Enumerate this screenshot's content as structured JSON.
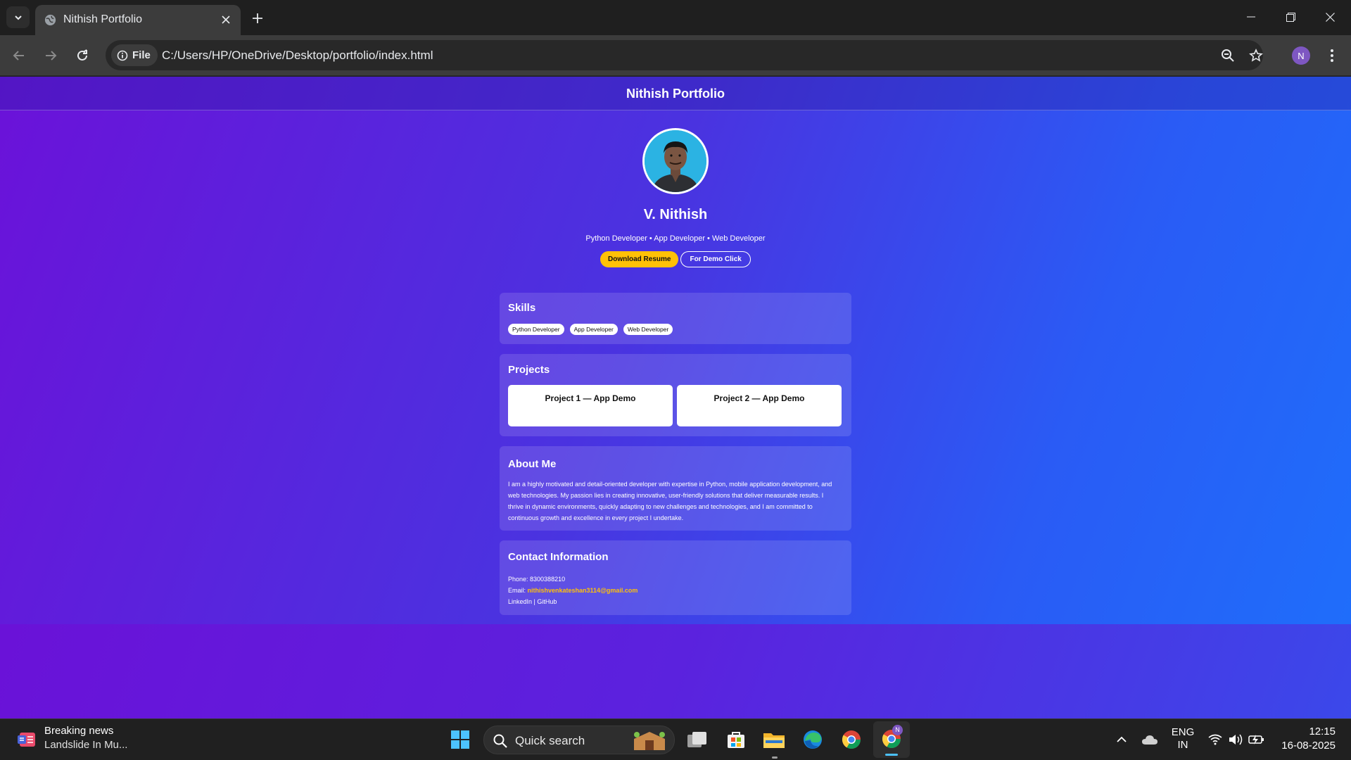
{
  "browser": {
    "tab_title": "Nithish Portfolio",
    "file_chip": "File",
    "url": "C:/Users/HP/OneDrive/Desktop/portfolio/index.html",
    "profile_initial": "N"
  },
  "page": {
    "header_title": "Nithish Portfolio",
    "name": "V. Nithish",
    "tagline": "Python Developer • App Developer • Web Developer",
    "buttons": {
      "resume": "Download Resume",
      "demo": "For Demo Click"
    },
    "skills": {
      "heading": "Skills",
      "items": [
        "Python Developer",
        "App Developer",
        "Web Developer"
      ]
    },
    "projects": {
      "heading": "Projects",
      "items": [
        "Project 1 — App Demo",
        "Project 2 — App Demo"
      ]
    },
    "about": {
      "heading": "About Me",
      "text": "I am a highly motivated and detail-oriented developer with expertise in Python, mobile application development, and web technologies. My passion lies in creating innovative, user-friendly solutions that deliver measurable results. I thrive in dynamic environments, quickly adapting to new challenges and technologies, and I am committed to continuous growth and excellence in every project I undertake."
    },
    "contact": {
      "heading": "Contact Information",
      "phone_label": "Phone: ",
      "phone": "8300388210",
      "email_label": "Email: ",
      "email": "nithishvenkateshan3114@gmail.com",
      "links": "LinkedIn | GitHub"
    }
  },
  "taskbar": {
    "news_title": "Breaking news",
    "news_sub": "Landslide In Mu...",
    "search_placeholder": "Quick search",
    "lang_top": "ENG",
    "lang_bottom": "IN",
    "time": "12:15",
    "date": "16-08-2025",
    "chrome_badge": "N"
  },
  "colors": {
    "accent_yellow": "#ffc107",
    "gradient_start": "#6b12d9",
    "gradient_end": "#1e6ffb"
  }
}
